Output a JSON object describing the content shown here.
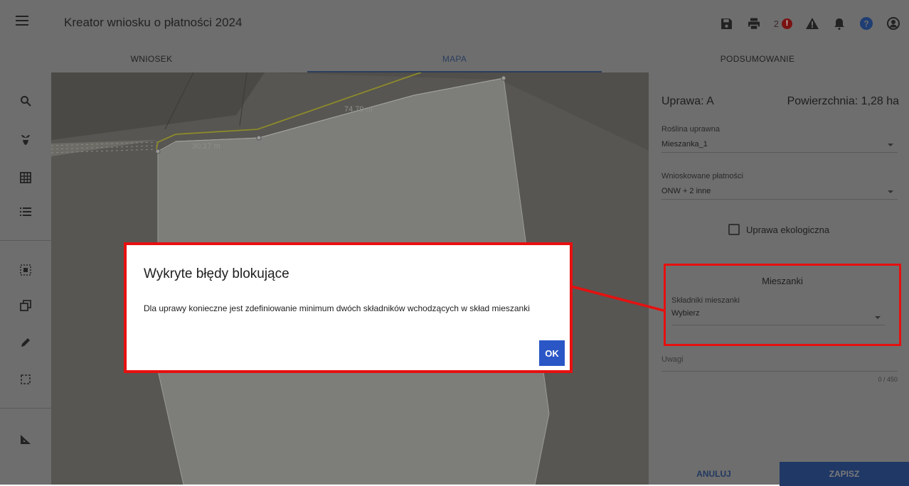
{
  "header": {
    "title": "Kreator wniosku o płatności 2024",
    "error_count": "2",
    "error_badge": "!"
  },
  "tabs": [
    {
      "label": "WNIOSEK"
    },
    {
      "label": "MAPA"
    },
    {
      "label": "PODSUMOWANIE"
    }
  ],
  "map": {
    "measurements": [
      "74,79 m",
      "30,17 m"
    ]
  },
  "panel": {
    "crop_label": "Uprawa: A",
    "area_label": "Powierzchnia: 1,28 ha",
    "plant_field": {
      "label": "Roślina uprawna",
      "value": "Mieszanka_1"
    },
    "payments_field": {
      "label": "Wnioskowane płatności",
      "value": "ONW + 2 inne"
    },
    "eco_label": "Uprawa ekologiczna",
    "mixtures": {
      "title": "Mieszanki",
      "field_label": "Składniki mieszanki",
      "field_value": "Wybierz"
    },
    "remarks_placeholder": "Uwagi",
    "char_counter": "0 / 450",
    "cancel_label": "ANULUJ",
    "save_label": "ZAPISZ"
  },
  "dialog": {
    "title": "Wykryte błędy blokujące",
    "message": "Dla uprawy konieczne jest zdefiniowanie minimum dwóch składników wchodzących w skład mieszanki",
    "ok_label": "OK"
  },
  "colors": {
    "highlight": "#e61010",
    "primary": "#2a56c6",
    "overlay": "#6e6e6e"
  },
  "icons": [
    "menu-icon",
    "save-icon",
    "print-icon",
    "error-icon",
    "warning-icon",
    "bell-icon",
    "help-icon",
    "account-icon",
    "search-icon",
    "plant-icon",
    "grid-icon",
    "list-icon",
    "select-area-icon",
    "copy-icon",
    "pencil-icon",
    "crop-select-icon",
    "ruler-icon"
  ]
}
